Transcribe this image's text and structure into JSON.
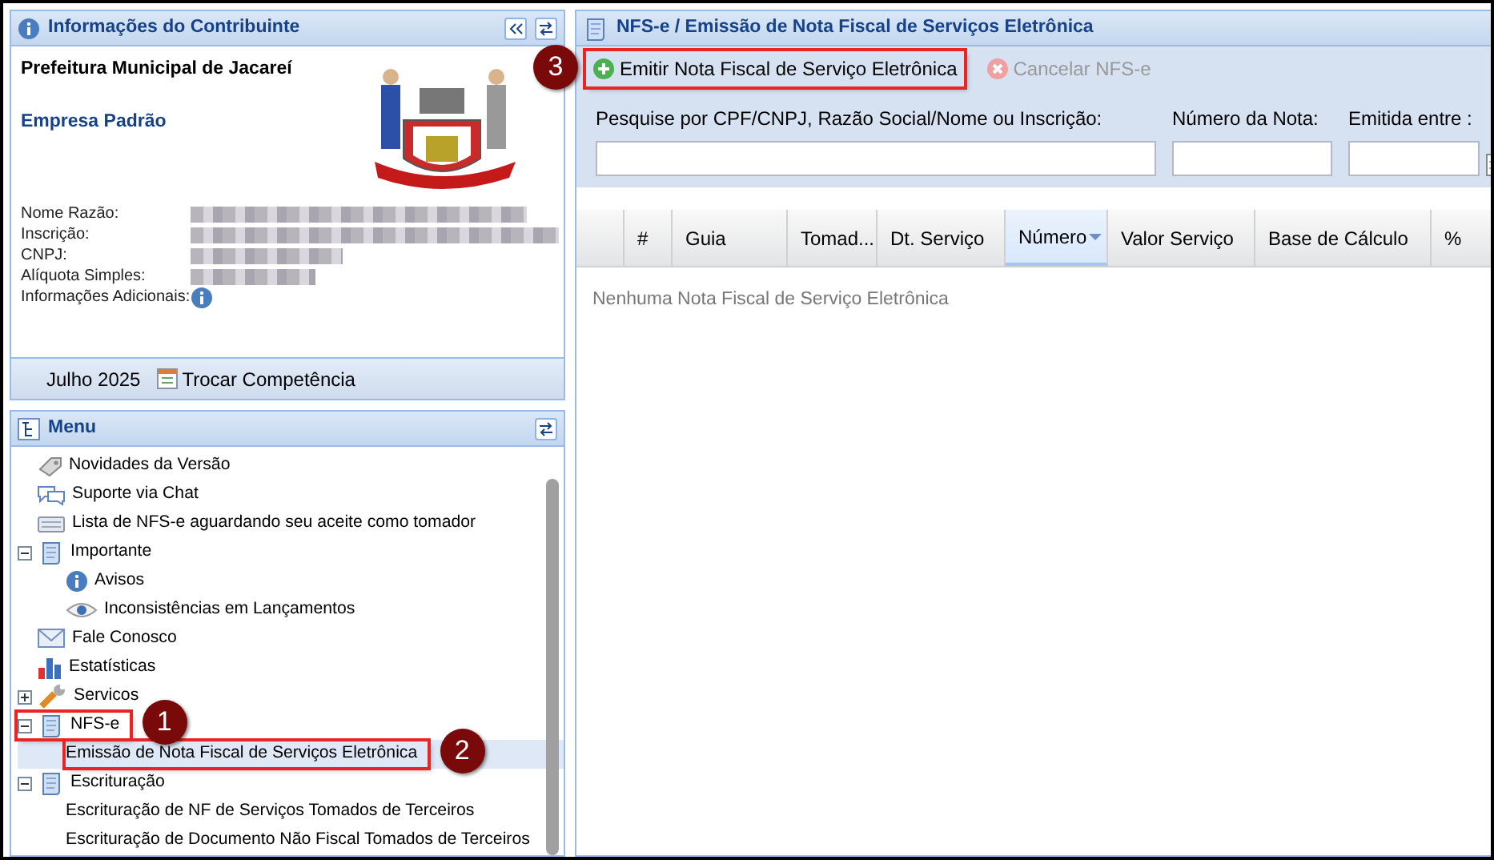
{
  "contributor_panel": {
    "title": "Informações do Contribuinte",
    "municipality": "Prefeitura Municipal de Jacareí",
    "company": "Empresa Padrão",
    "fields": [
      {
        "label": "Nome Razão:",
        "kind": "redacted"
      },
      {
        "label": "Inscrição:",
        "kind": "redacted"
      },
      {
        "label": "CNPJ:",
        "kind": "redacted"
      },
      {
        "label": "Alíquota Simples:",
        "kind": "redacted"
      },
      {
        "label": "Informações Adicionais:",
        "kind": "info"
      }
    ],
    "period": "Julho 2025",
    "change_period_button": "Trocar Competência"
  },
  "menu": {
    "title": "Menu",
    "items": [
      {
        "label": "Novidades da Versão",
        "kind": "tag",
        "selected": false
      },
      {
        "label": "Suporte via Chat",
        "kind": "chat",
        "selected": false
      },
      {
        "label": "Lista de NFS-e aguardando seu aceite como tomador",
        "kind": "keyboard",
        "selected": false
      },
      {
        "label": "Importante",
        "kind": "folder",
        "expanded": true,
        "selected": false,
        "children": [
          {
            "label": "Avisos",
            "kind": "info",
            "selected": false
          },
          {
            "label": "Inconsistências em Lançamentos",
            "kind": "eye",
            "selected": false
          }
        ]
      },
      {
        "label": "Fale Conosco",
        "kind": "mail",
        "selected": false
      },
      {
        "label": "Estatísticas",
        "kind": "chart",
        "selected": false
      },
      {
        "label": "Servicos",
        "kind": "wrench",
        "expanded": false,
        "selected": false
      },
      {
        "label": "NFS-e",
        "kind": "folder",
        "expanded": true,
        "selected": false,
        "callout": "1",
        "children": [
          {
            "label": "Emissão de Nota Fiscal de Serviços Eletrônica",
            "kind": "plain",
            "selected": true,
            "callout": "2"
          }
        ]
      },
      {
        "label": "Escrituração",
        "kind": "folder",
        "expanded": true,
        "selected": false,
        "children": [
          {
            "label": "Escrituração de NF de Serviços Tomados de Terceiros",
            "kind": "plain",
            "selected": false
          },
          {
            "label": "Escrituração de Documento Não Fiscal Tomados de Terceiros",
            "kind": "plain",
            "selected": false
          }
        ]
      }
    ]
  },
  "main_panel": {
    "title": "NFS-e / Emissão de Nota Fiscal de Serviços Eletrônica",
    "toolbar": [
      {
        "label": "Emitir Nota Fiscal de Serviço Eletrônica",
        "kind": "add",
        "disabled": false,
        "callout": "3"
      },
      {
        "label": "Cancelar NFS-e",
        "kind": "cancel",
        "disabled": true
      }
    ],
    "filters": [
      {
        "label": "Pesquise por CPF/CNPJ, Razão Social/Nome ou Inscrição:",
        "kind": "text"
      },
      {
        "label": "Número da Nota:",
        "kind": "text"
      },
      {
        "label": "Emitida entre :",
        "kind": "date"
      }
    ],
    "table": {
      "columns": [
        {
          "label": "#",
          "sorted": false
        },
        {
          "label": "Guia",
          "sorted": false
        },
        {
          "label": "Tomad...",
          "sorted": false
        },
        {
          "label": "Dt. Serviço",
          "sorted": false
        },
        {
          "label": "Número",
          "sorted": true
        },
        {
          "label": "Valor Serviço",
          "sorted": false
        },
        {
          "label": "Base de Cálculo",
          "sorted": false
        },
        {
          "label": "%",
          "sorted": false
        }
      ],
      "empty_text": "Nenhuma Nota Fiscal de Serviço Eletrônica"
    }
  }
}
